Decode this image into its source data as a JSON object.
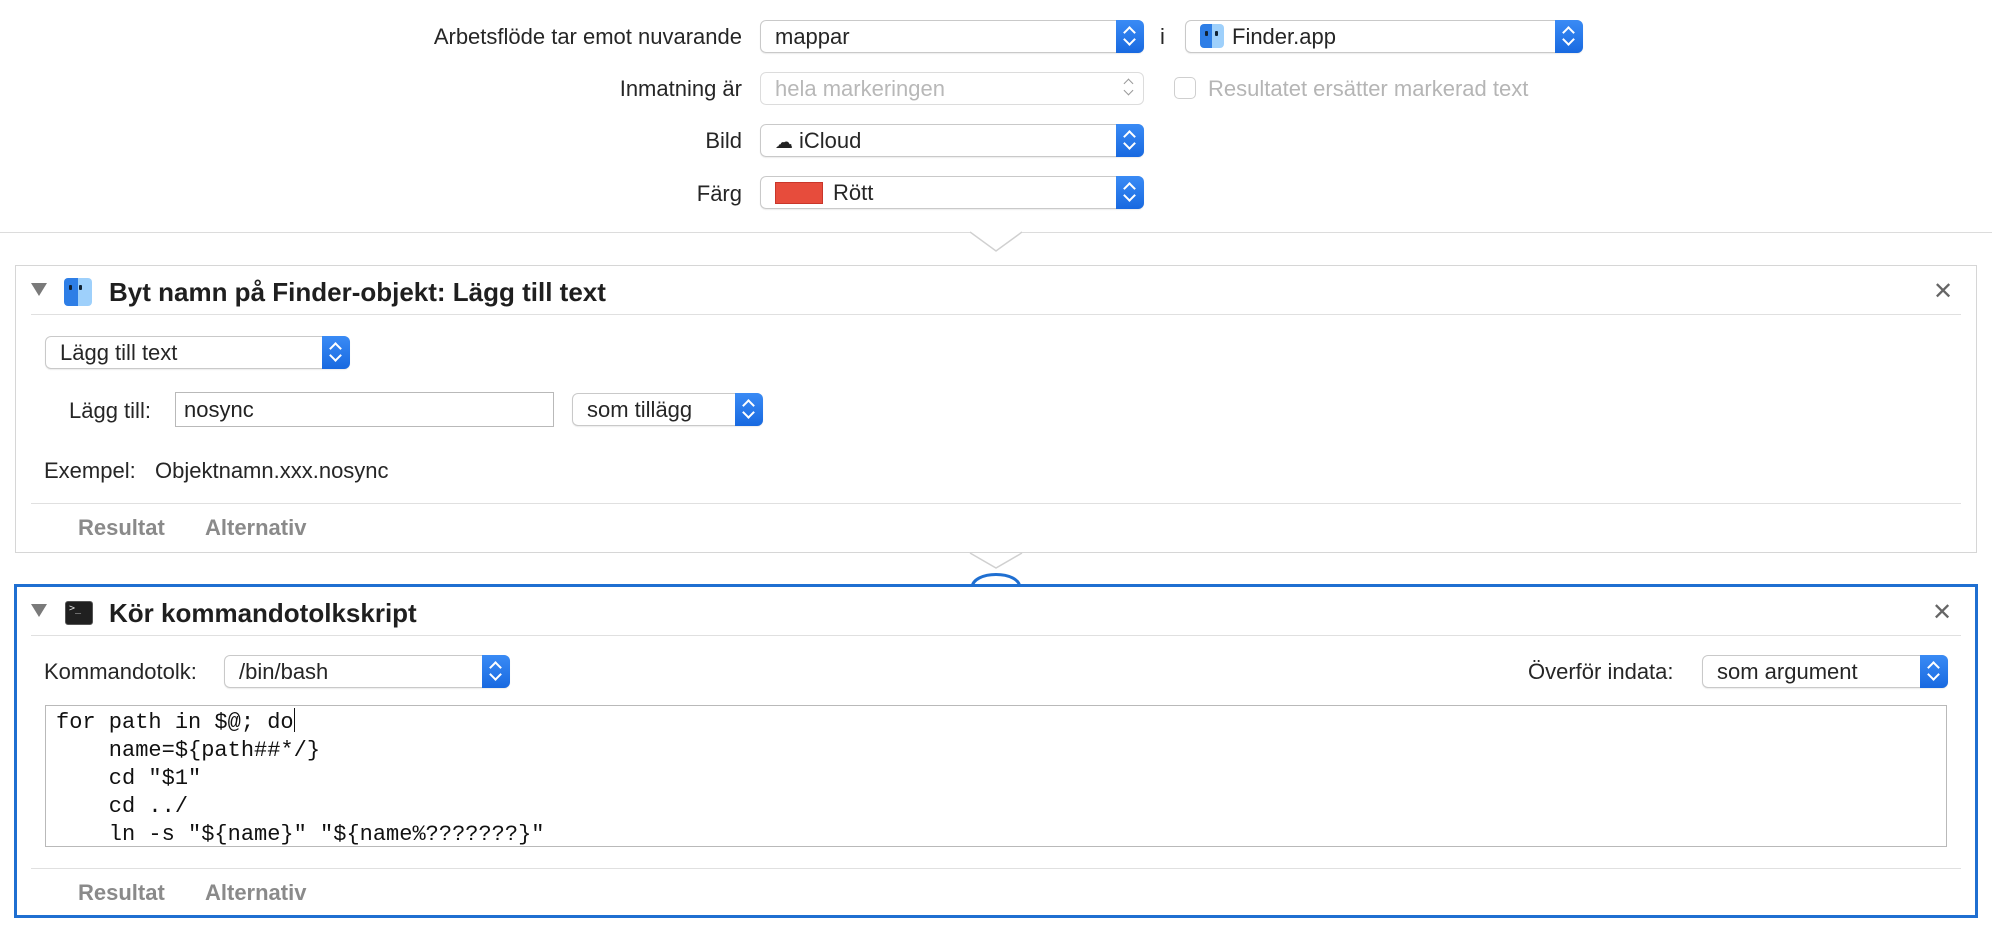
{
  "workflow_header": {
    "receives_label": "Arbetsflöde tar emot nuvarande",
    "receives_value": "mappar",
    "in_label": "i",
    "app_value": "Finder.app",
    "input_label": "Inmatning är",
    "input_value": "hela markeringen",
    "replace_checkbox_label": "Resultatet ersätter markerad text",
    "image_label": "Bild",
    "image_value": "iCloud",
    "image_icon": "cloud-icon",
    "color_label": "Färg",
    "color_value": "Rött",
    "color_swatch": "#e74c3c"
  },
  "rename_action": {
    "title": "Byt namn på Finder-objekt: Lägg till text",
    "icon": "finder-icon",
    "mode_value": "Lägg till text",
    "add_label": "Lägg till:",
    "add_value": "nosync",
    "position_value": "som tillägg",
    "example_label": "Exempel:",
    "example_value": "Objektnamn.xxx.nosync",
    "tab_results": "Resultat",
    "tab_options": "Alternativ"
  },
  "shell_action": {
    "title": "Kör kommandotolkskript",
    "icon": "terminal-icon",
    "shell_label": "Kommandotolk:",
    "shell_value": "/bin/bash",
    "pass_input_label": "Överför indata:",
    "pass_input_value": "som argument",
    "script_lines": [
      "for path in $@; do",
      "    name=${path##*/}",
      "    cd \"$1\"",
      "    cd ../",
      "    ln -s \"${name}\" \"${name%???????}\""
    ],
    "tab_results": "Resultat",
    "tab_options": "Alternativ"
  },
  "colors": {
    "accent": "#1f6fd1",
    "stepper_blue": "#2a7bef"
  }
}
